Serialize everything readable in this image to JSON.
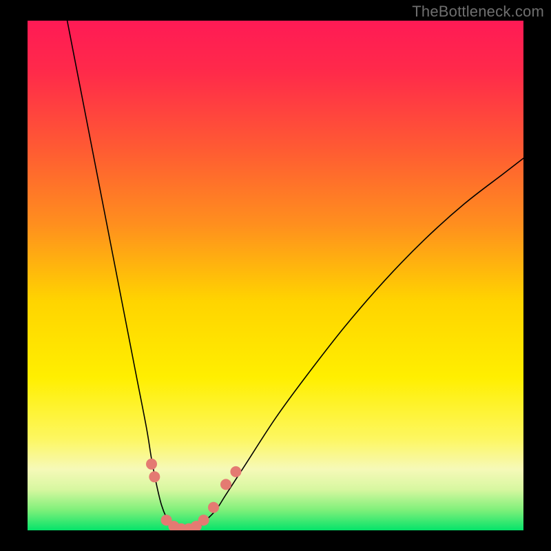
{
  "watermark": "TheBottleneck.com",
  "chart_data": {
    "type": "line",
    "title": "",
    "xlabel": "",
    "ylabel": "",
    "xlim": [
      0,
      100
    ],
    "ylim": [
      0,
      100
    ],
    "grid": false,
    "legend": false,
    "background_gradient": {
      "stops": [
        {
          "offset": 0.0,
          "color": "#ff1a55"
        },
        {
          "offset": 0.1,
          "color": "#ff2a4a"
        },
        {
          "offset": 0.25,
          "color": "#ff5a33"
        },
        {
          "offset": 0.4,
          "color": "#ff8f1e"
        },
        {
          "offset": 0.55,
          "color": "#ffd400"
        },
        {
          "offset": 0.7,
          "color": "#ffef00"
        },
        {
          "offset": 0.82,
          "color": "#fdf760"
        },
        {
          "offset": 0.88,
          "color": "#f6f9b8"
        },
        {
          "offset": 0.92,
          "color": "#d7f7a0"
        },
        {
          "offset": 0.96,
          "color": "#7ff07a"
        },
        {
          "offset": 1.0,
          "color": "#05e36a"
        }
      ]
    },
    "series": [
      {
        "name": "bottleneck-curve-left",
        "stroke": "#000000",
        "stroke_width": 1.6,
        "x": [
          8,
          10,
          12,
          14,
          16,
          18,
          20,
          22,
          24,
          25,
          26,
          27,
          28,
          29,
          30
        ],
        "y": [
          100,
          90,
          80,
          70,
          60,
          50,
          40,
          30,
          20,
          14,
          9,
          5,
          2.5,
          1,
          0.5
        ]
      },
      {
        "name": "bottleneck-curve-right",
        "stroke": "#000000",
        "stroke_width": 1.6,
        "x": [
          34,
          35,
          36,
          38,
          40,
          44,
          50,
          56,
          64,
          72,
          80,
          88,
          96,
          100
        ],
        "y": [
          0.5,
          1,
          2,
          4,
          7,
          13,
          22,
          30,
          40,
          49,
          57,
          64,
          70,
          73
        ]
      },
      {
        "name": "bottleneck-curve-floor",
        "stroke": "#000000",
        "stroke_width": 1.6,
        "x": [
          30,
          31,
          32,
          33,
          34
        ],
        "y": [
          0.5,
          0.2,
          0.15,
          0.2,
          0.5
        ]
      }
    ],
    "markers": [
      {
        "x": 25.0,
        "y": 13.0,
        "r": 8,
        "color": "#e47a72"
      },
      {
        "x": 25.6,
        "y": 10.5,
        "r": 8,
        "color": "#e47a72"
      },
      {
        "x": 28.0,
        "y": 2.0,
        "r": 8,
        "color": "#e47a72"
      },
      {
        "x": 29.5,
        "y": 0.8,
        "r": 8,
        "color": "#e47a72"
      },
      {
        "x": 31.0,
        "y": 0.3,
        "r": 8,
        "color": "#e47a72"
      },
      {
        "x": 32.5,
        "y": 0.3,
        "r": 8,
        "color": "#e47a72"
      },
      {
        "x": 34.0,
        "y": 0.8,
        "r": 8,
        "color": "#e47a72"
      },
      {
        "x": 35.5,
        "y": 2.0,
        "r": 8,
        "color": "#e47a72"
      },
      {
        "x": 37.5,
        "y": 4.5,
        "r": 8,
        "color": "#e47a72"
      },
      {
        "x": 40.0,
        "y": 9.0,
        "r": 8,
        "color": "#e47a72"
      },
      {
        "x": 42.0,
        "y": 11.5,
        "r": 8,
        "color": "#e47a72"
      }
    ]
  }
}
